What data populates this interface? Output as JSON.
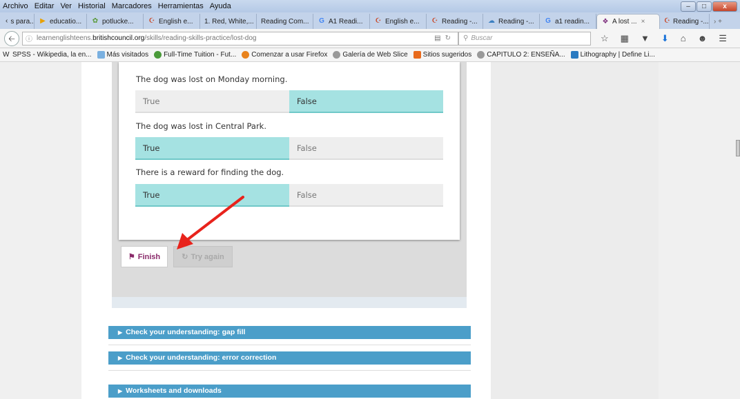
{
  "menubar": {
    "items": [
      "Archivo",
      "Editar",
      "Ver",
      "Historial",
      "Marcadores",
      "Herramientas",
      "Ayuda"
    ],
    "window_controls": [
      "–",
      "□",
      "x"
    ]
  },
  "tabs": [
    {
      "icon": "chevron-left-icon",
      "label": "s para..."
    },
    {
      "icon": "play-icon",
      "label": "educatio..."
    },
    {
      "icon": "potlucke-icon",
      "label": "potlucke..."
    },
    {
      "icon": "kanji-icon",
      "label": "English e..."
    },
    {
      "icon": "",
      "label": "1. Red, White,..."
    },
    {
      "icon": "",
      "label": "Reading Com..."
    },
    {
      "icon": "google-icon",
      "label": "A1 Readi..."
    },
    {
      "icon": "kanji-icon",
      "label": "English e..."
    },
    {
      "icon": "kanji-icon",
      "label": "Reading -..."
    },
    {
      "icon": "reading-icon",
      "label": "Reading -..."
    },
    {
      "icon": "google-icon",
      "label": "a1 readin..."
    },
    {
      "icon": "bc-icon",
      "label": "A lost ...",
      "active": true,
      "close": "×"
    },
    {
      "icon": "kanji-icon",
      "label": "Reading -..."
    }
  ],
  "tab_extra": "›  +",
  "nav": {
    "url_prefix": "learnenglishteens.",
    "url_domain": "britishcouncil.org",
    "url_path": "/skills/reading-skills-practice/lost-dog",
    "search_placeholder": "Buscar"
  },
  "bookmarks": [
    "SPSS - Wikipedia, la en...",
    "Más visitados",
    "Full-Time Tuition - Fut...",
    "Comenzar a usar Firefox",
    "Galería de Web Slice",
    "Sitios sugeridos",
    "CAPITULO 2: ENSEÑA...",
    "Lithography | Define Li..."
  ],
  "quiz": {
    "questions": [
      {
        "text": "The dog was lost on Monday morning.",
        "true_label": "True",
        "false_label": "False",
        "selected": "False"
      },
      {
        "text": "The dog was lost in Central Park.",
        "true_label": "True",
        "false_label": "False",
        "selected": "True"
      },
      {
        "text": "There is a reward for finding the dog.",
        "true_label": "True",
        "false_label": "False",
        "selected": "True"
      }
    ],
    "finish_label": "Finish",
    "try_again_label": "Try again"
  },
  "accordions": [
    "Check your understanding: gap fill",
    "Check your understanding: error correction",
    "Worksheets and downloads"
  ],
  "colors": {
    "selected_option": "#a5e2e2",
    "accordion": "#4b9ec9",
    "finish_text": "#8a2a6a",
    "arrow": "#e8231c"
  }
}
